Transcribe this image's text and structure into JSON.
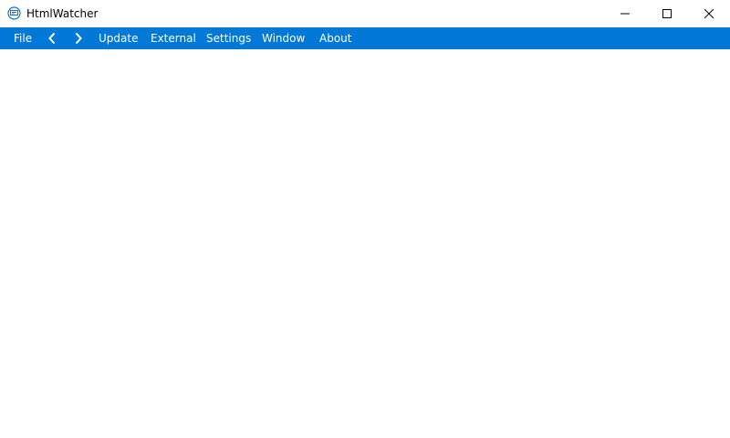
{
  "window": {
    "title": "HtmlWatcher",
    "controls": {
      "minimize": "minimize-icon",
      "maximize": "maximize-icon",
      "close": "close-icon"
    }
  },
  "menubar": {
    "file": "File",
    "back": "chevron-left-icon",
    "forward": "chevron-right-icon",
    "update": "Update",
    "external": "External",
    "settings": "Settings",
    "window": "Window",
    "about": "About"
  },
  "colors": {
    "accent": "#0078d7",
    "menu_text": "#ffffff",
    "title_text": "#000000",
    "content_bg": "#ffffff"
  }
}
